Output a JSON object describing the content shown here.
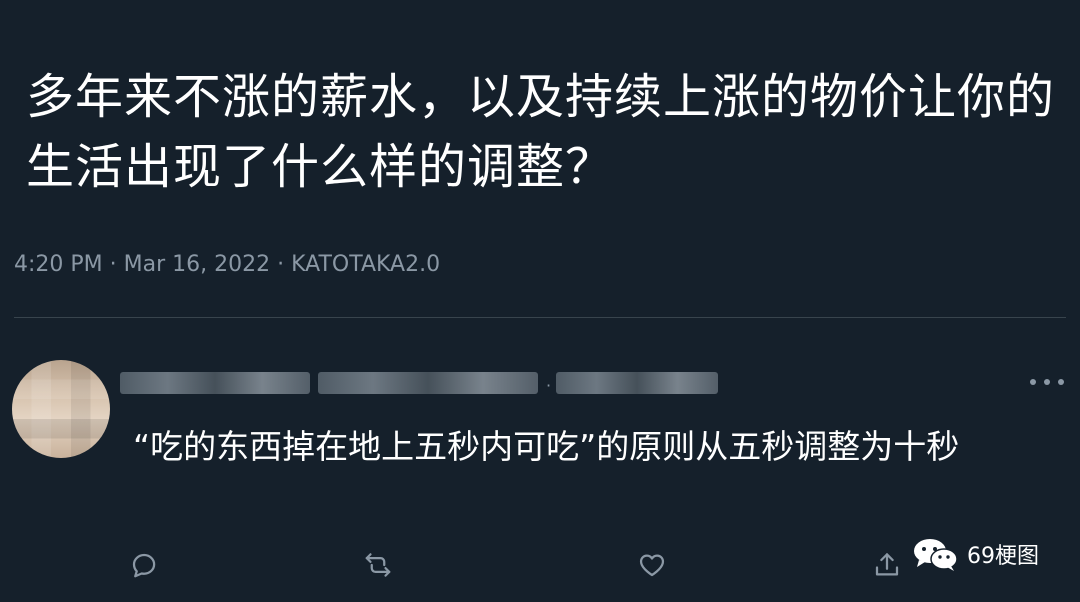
{
  "tweet": {
    "text": "多年来不涨的薪水，以及持续上涨的物价让你的生活出现了什么样的调整？",
    "meta": "4:20 PM · Mar 16, 2022 · KATOTAKA2.0"
  },
  "reply": {
    "text": "“吃的东西掉在地上五秒内可吃”的原则从五秒调整为十秒",
    "separator": "·"
  },
  "actions": [
    "reply-icon",
    "retweet-icon",
    "like-icon",
    "share-icon"
  ],
  "watermark": {
    "label": "69梗图"
  },
  "colors": {
    "background": "#15202b",
    "text": "#ffffff",
    "secondary": "#8b98a5",
    "divider": "#38444d"
  }
}
